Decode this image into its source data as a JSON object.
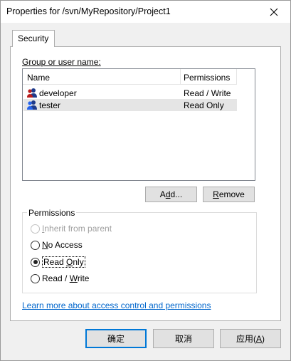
{
  "window": {
    "title": "Properties for /svn/MyRepository/Project1"
  },
  "tabs": [
    {
      "label": "Security"
    }
  ],
  "security": {
    "group_label": "Group or user name:",
    "columns": {
      "name": "Name",
      "permissions": "Permissions"
    },
    "users": [
      {
        "name": "developer",
        "permission": "Read / Write",
        "selected": false
      },
      {
        "name": "tester",
        "permission": "Read Only",
        "selected": true
      }
    ],
    "add_button": {
      "pre": "A",
      "mn": "d",
      "post": "d..."
    },
    "remove_button": {
      "mn": "R",
      "post": "emove"
    }
  },
  "permissions": {
    "legend": "Permissions",
    "options": [
      {
        "mn": "I",
        "rest": "nherit from parent",
        "state": "disabled"
      },
      {
        "mn": "N",
        "rest": "o Access",
        "state": "unchecked"
      },
      {
        "pre": "Read ",
        "mn": "O",
        "rest": "nly",
        "state": "checked"
      },
      {
        "pre": "Read / ",
        "mn": "W",
        "rest": "rite",
        "state": "unchecked"
      }
    ]
  },
  "link_text": "Learn more about access control and permissions",
  "footer": {
    "ok": "确定",
    "cancel": "取消",
    "apply_pre": "应用(",
    "apply_mn": "A",
    "apply_post": ")"
  },
  "colors": {
    "link": "#0066cc",
    "default_button_border": "#0078d7",
    "selection": "#e5e5e5"
  }
}
